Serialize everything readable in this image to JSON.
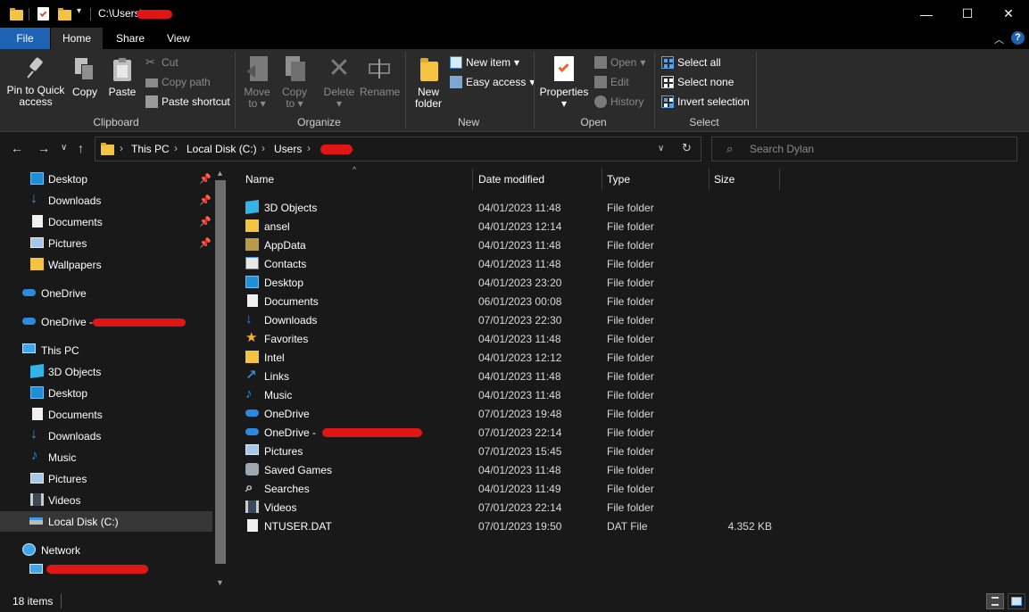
{
  "window": {
    "path": "C:\\Users\\",
    "controls": {
      "minimize": "—",
      "maximize": "☐",
      "close": "✕"
    }
  },
  "ribbon_tabs": [
    {
      "label": "File"
    },
    {
      "label": "Home"
    },
    {
      "label": "Share"
    },
    {
      "label": "View"
    }
  ],
  "ribbon": {
    "clipboard": {
      "label": "Clipboard",
      "pin": "Pin to Quick access",
      "pin_l1": "Pin to Quick",
      "pin_l2": "access",
      "copy": "Copy",
      "paste": "Paste",
      "cut": "Cut",
      "copy_path": "Copy path",
      "paste_shortcut": "Paste shortcut"
    },
    "organize": {
      "label": "Organize",
      "move_to_l1": "Move",
      "move_to_l2": "to",
      "copy_to_l1": "Copy",
      "copy_to_l2": "to",
      "delete": "Delete",
      "rename": "Rename"
    },
    "new": {
      "label": "New",
      "new_folder_l1": "New",
      "new_folder_l2": "folder",
      "new_item": "New item",
      "easy_access": "Easy access"
    },
    "open": {
      "label": "Open",
      "properties": "Properties",
      "open": "Open",
      "edit": "Edit",
      "history": "History"
    },
    "select": {
      "label": "Select",
      "select_all": "Select all",
      "select_none": "Select none",
      "invert": "Invert selection"
    }
  },
  "address": {
    "crumbs": [
      "This PC",
      "Local Disk (C:)",
      "Users"
    ],
    "search_placeholder": "Search Dylan"
  },
  "sidebar": {
    "quick_access": [
      {
        "label": "Desktop",
        "icon": "desktop-icon",
        "pinned": true
      },
      {
        "label": "Downloads",
        "icon": "downloads-icon",
        "pinned": true
      },
      {
        "label": "Documents",
        "icon": "documents-icon",
        "pinned": true
      },
      {
        "label": "Pictures",
        "icon": "pictures-icon",
        "pinned": true
      },
      {
        "label": "Wallpapers",
        "icon": "folder-icon",
        "pinned": false
      }
    ],
    "onedrive": "OneDrive",
    "onedrive_business": "OneDrive -",
    "this_pc": "This PC",
    "this_pc_items": [
      {
        "label": "3D Objects",
        "icon": "3d-objects-icon"
      },
      {
        "label": "Desktop",
        "icon": "desktop-icon"
      },
      {
        "label": "Documents",
        "icon": "documents-icon"
      },
      {
        "label": "Downloads",
        "icon": "downloads-icon"
      },
      {
        "label": "Music",
        "icon": "music-icon"
      },
      {
        "label": "Pictures",
        "icon": "pictures-icon"
      },
      {
        "label": "Videos",
        "icon": "videos-icon"
      },
      {
        "label": "Local Disk (C:)",
        "icon": "drive-icon",
        "selected": true
      }
    ],
    "network": "Network"
  },
  "columns": {
    "name": "Name",
    "date": "Date modified",
    "type": "Type",
    "size": "Size"
  },
  "files": [
    {
      "name": "3D Objects",
      "date": "04/01/2023 11:48",
      "type": "File folder",
      "size": "",
      "icon": "3d-objects-icon"
    },
    {
      "name": "ansel",
      "date": "04/01/2023 12:14",
      "type": "File folder",
      "size": "",
      "icon": "folder-icon"
    },
    {
      "name": "AppData",
      "date": "04/01/2023 11:48",
      "type": "File folder",
      "size": "",
      "icon": "hidden-folder-icon"
    },
    {
      "name": "Contacts",
      "date": "04/01/2023 11:48",
      "type": "File folder",
      "size": "",
      "icon": "contacts-icon"
    },
    {
      "name": "Desktop",
      "date": "04/01/2023 23:20",
      "type": "File folder",
      "size": "",
      "icon": "desktop-icon"
    },
    {
      "name": "Documents",
      "date": "06/01/2023 00:08",
      "type": "File folder",
      "size": "",
      "icon": "documents-icon"
    },
    {
      "name": "Downloads",
      "date": "07/01/2023 22:30",
      "type": "File folder",
      "size": "",
      "icon": "downloads-icon"
    },
    {
      "name": "Favorites",
      "date": "04/01/2023 11:48",
      "type": "File folder",
      "size": "",
      "icon": "favorites-icon"
    },
    {
      "name": "Intel",
      "date": "04/01/2023 12:12",
      "type": "File folder",
      "size": "",
      "icon": "folder-icon"
    },
    {
      "name": "Links",
      "date": "04/01/2023 11:48",
      "type": "File folder",
      "size": "",
      "icon": "links-icon"
    },
    {
      "name": "Music",
      "date": "04/01/2023 11:48",
      "type": "File folder",
      "size": "",
      "icon": "music-icon"
    },
    {
      "name": "OneDrive",
      "date": "07/01/2023 19:48",
      "type": "File folder",
      "size": "",
      "icon": "onedrive-icon"
    },
    {
      "name": "OneDrive -",
      "date": "07/01/2023 22:14",
      "type": "File folder",
      "size": "",
      "icon": "onedrive-icon"
    },
    {
      "name": "Pictures",
      "date": "07/01/2023 15:45",
      "type": "File folder",
      "size": "",
      "icon": "pictures-icon"
    },
    {
      "name": "Saved Games",
      "date": "04/01/2023 11:48",
      "type": "File folder",
      "size": "",
      "icon": "saved-games-icon"
    },
    {
      "name": "Searches",
      "date": "04/01/2023 11:49",
      "type": "File folder",
      "size": "",
      "icon": "searches-icon"
    },
    {
      "name": "Videos",
      "date": "07/01/2023 22:14",
      "type": "File folder",
      "size": "",
      "icon": "videos-icon"
    },
    {
      "name": "NTUSER.DAT",
      "date": "07/01/2023 19:50",
      "type": "DAT File",
      "size": "4.352 KB",
      "icon": "file-icon"
    }
  ],
  "status": {
    "count": "18 items"
  },
  "colors": {
    "accent": "#1c62b5",
    "folder": "#f5c342",
    "background": "#191919",
    "ribbon": "#2b2b2b",
    "redaction": "#e01515"
  }
}
